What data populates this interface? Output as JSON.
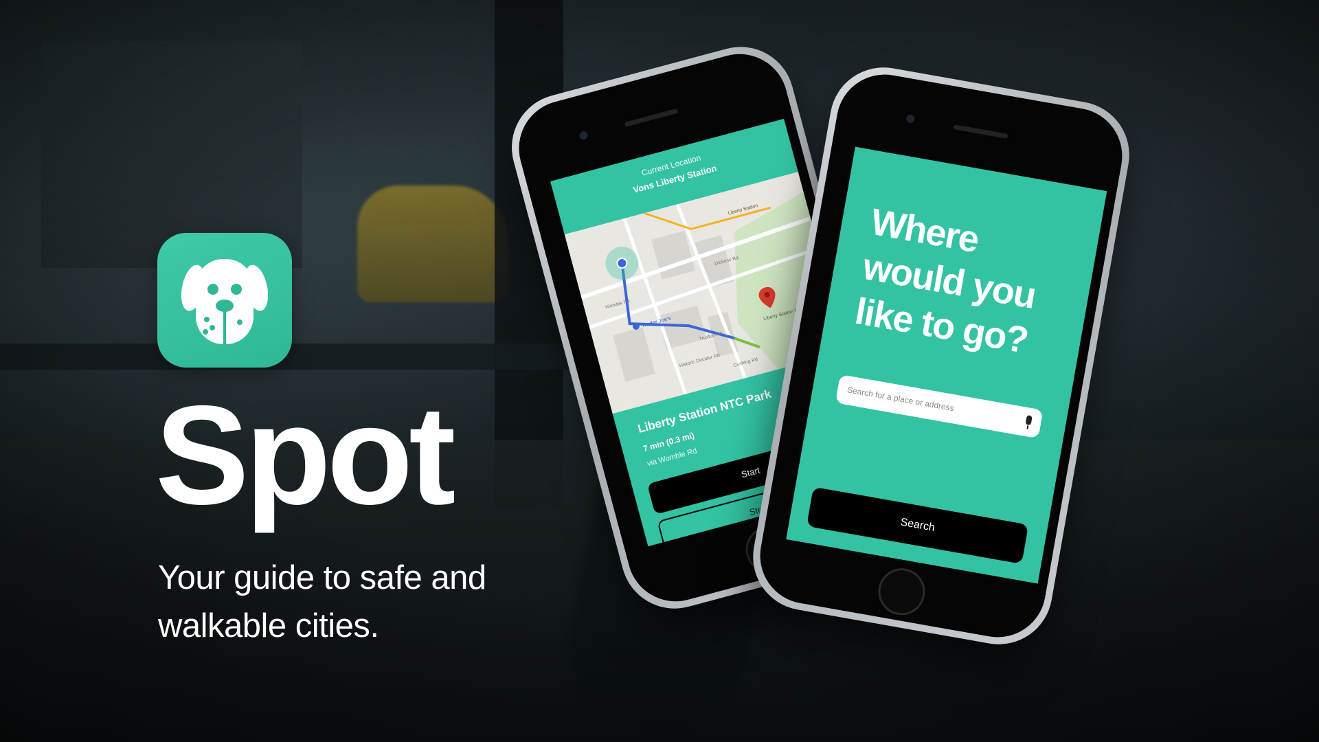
{
  "brand": {
    "name": "Spot",
    "tagline": "Your guide to safe and walkable cities.",
    "icon": "dog-face-icon",
    "accent_color": "#33c3a3"
  },
  "phone_map": {
    "current_location_label": "Current Location",
    "current_location_name": "Vons Liberty Station",
    "map_labels": {
      "store": "Trader Joe's",
      "station": "Liberty Station",
      "park": "Liberty Station NTC Park",
      "road_womble": "Womble Rd",
      "road_historic": "Historic Decatur Rd",
      "road_truxtun": "Truxtun Rd",
      "road_dickens": "Dickens Rd",
      "road_cushing": "Cushing Rd"
    },
    "destination": "Liberty Station NTC Park",
    "duration": "7 min (0.3 mi)",
    "route_via": "via Womble Rd",
    "start_label": "Start",
    "steps_label": "Steps",
    "close_icon": "close-icon"
  },
  "phone_search": {
    "headline": "Where would you like to go?",
    "search_placeholder": "Search for a place or address",
    "mic_icon": "microphone-icon",
    "search_button_label": "Search"
  }
}
